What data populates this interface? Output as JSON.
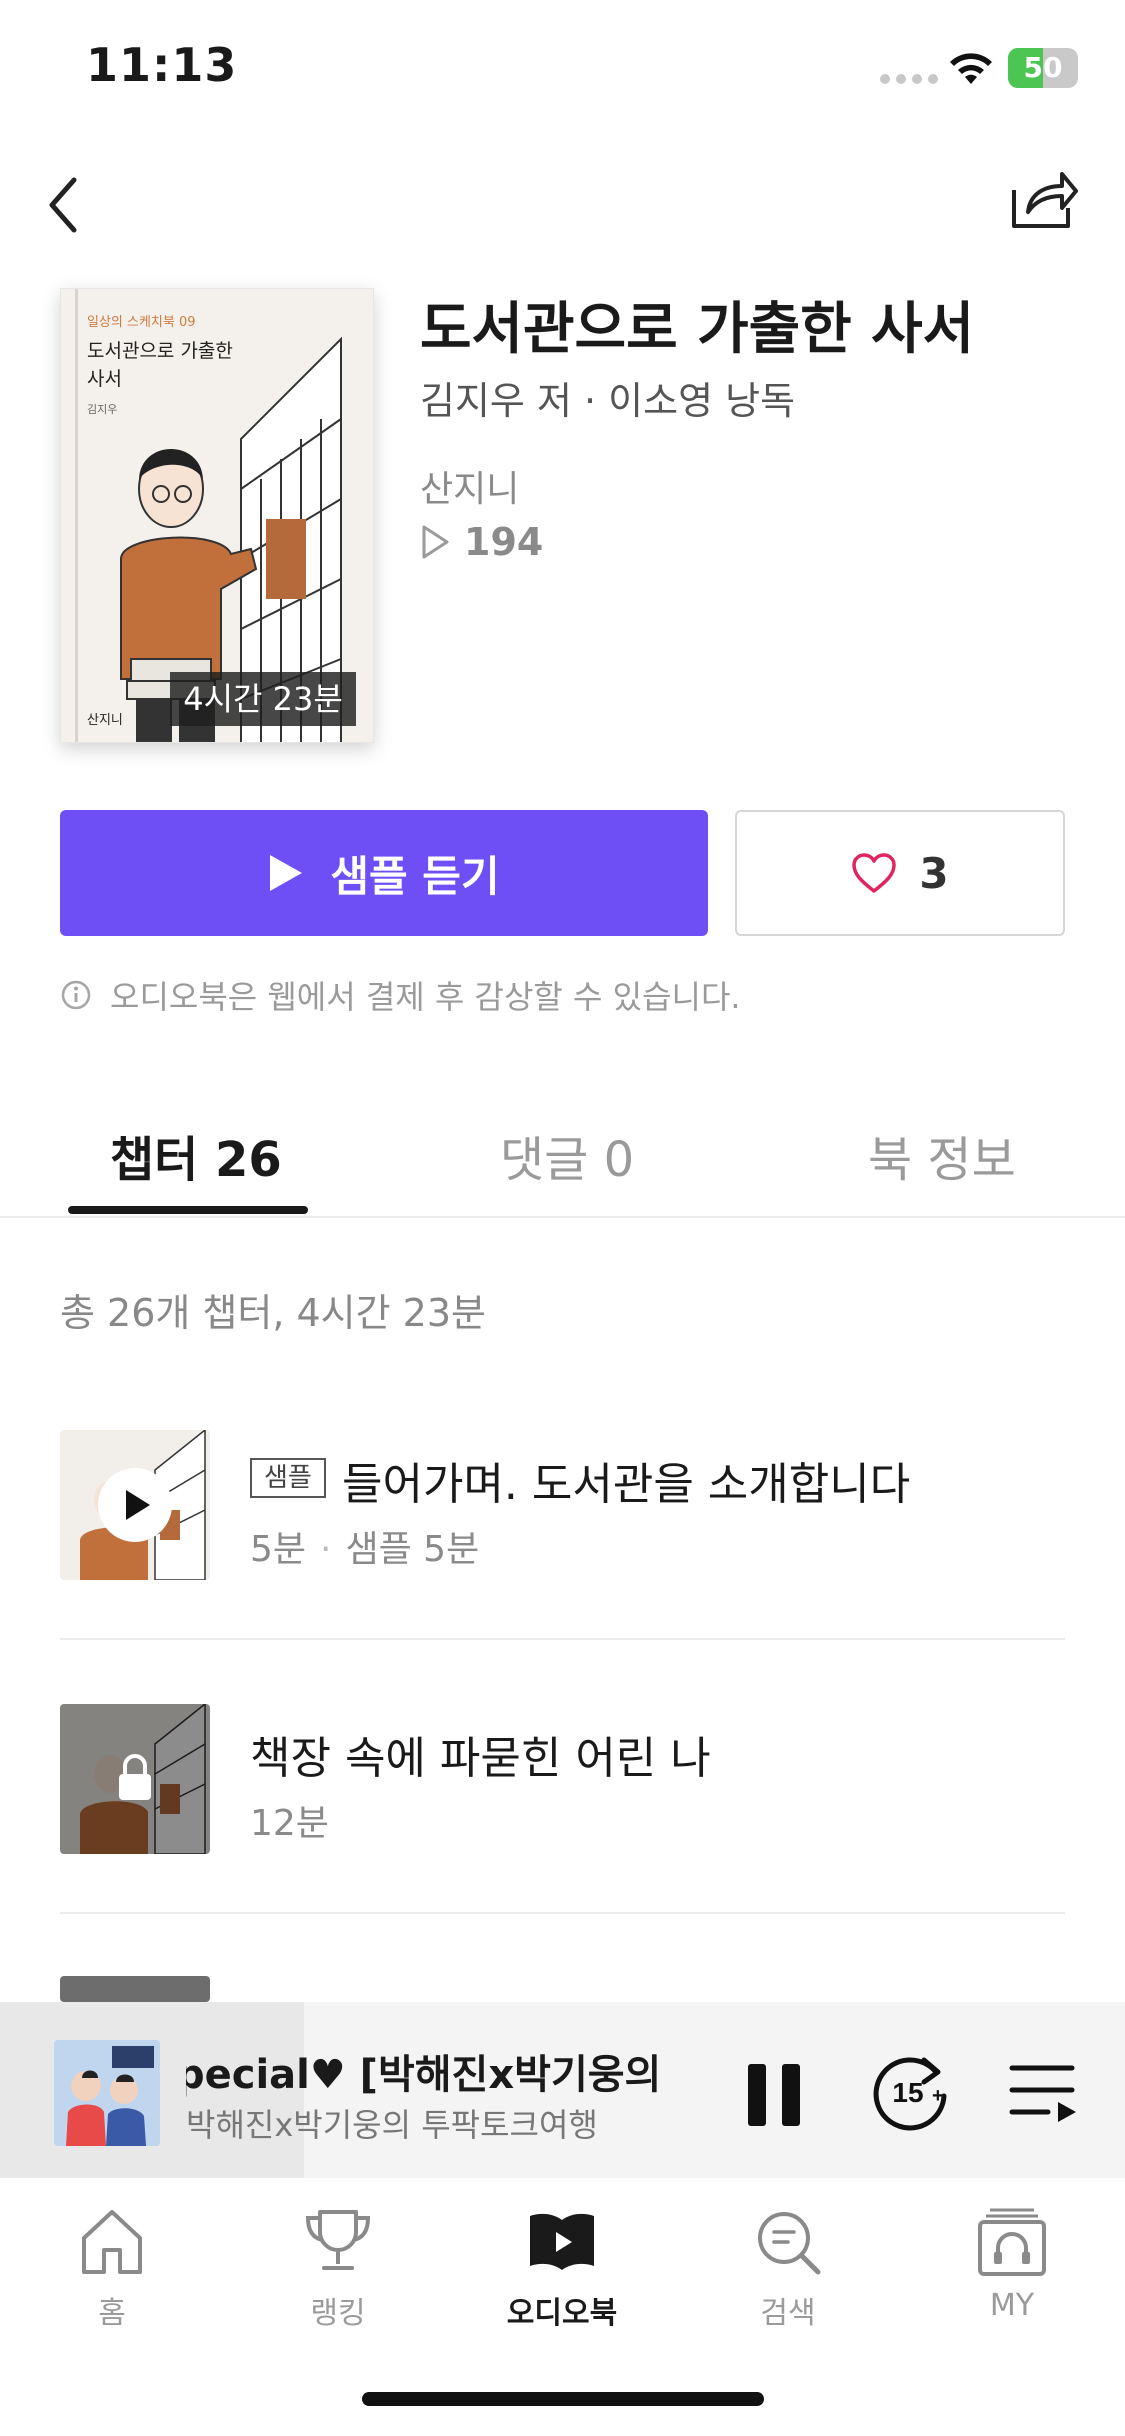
{
  "status_bar": {
    "time": "11:13",
    "battery": "50",
    "battery_level": 0.5
  },
  "book": {
    "title": "도서관으로 가출한 사서",
    "authors": "김지우 저 · 이소영 낭독",
    "publisher": "산지니",
    "play_count": "194",
    "duration": "4시간 23분",
    "cover": {
      "series": "일상의 스케치북 09",
      "title": "도서관으로 가출한 사서",
      "author": "김지우",
      "publisher": "산지니"
    }
  },
  "actions": {
    "sample_label": "샘플 듣기",
    "like_count": "3",
    "notice": "오디오북은 웹에서 결제 후 감상할 수 있습니다."
  },
  "tabs": [
    {
      "label": "챕터 26"
    },
    {
      "label": "댓글 0"
    },
    {
      "label": "북 정보"
    }
  ],
  "chapter_summary": "총 26개 챕터, 4시간 23분",
  "chapters": [
    {
      "badge": "샘플",
      "title": "들어가며. 도서관을 소개합니다",
      "length": "5분",
      "sample": "샘플 5분"
    },
    {
      "title": "책장 속에 파묻힌 어린 나",
      "length": "12분"
    }
  ],
  "mini_player": {
    "title": "pecial♥    [박해진x박기웅의",
    "subtitle": "박해진x박기웅의 투팍토크여행",
    "progress": 0.27,
    "skip_label": "15"
  },
  "bottom_nav": [
    {
      "label": "홈",
      "icon": "home-icon"
    },
    {
      "label": "랭킹",
      "icon": "trophy-icon"
    },
    {
      "label": "오디오북",
      "icon": "audiobook-icon"
    },
    {
      "label": "검색",
      "icon": "search-icon"
    },
    {
      "label": "MY",
      "icon": "headphones-icon"
    }
  ],
  "colors": {
    "accent": "#6e4ff6",
    "heart": "#e0245e"
  }
}
